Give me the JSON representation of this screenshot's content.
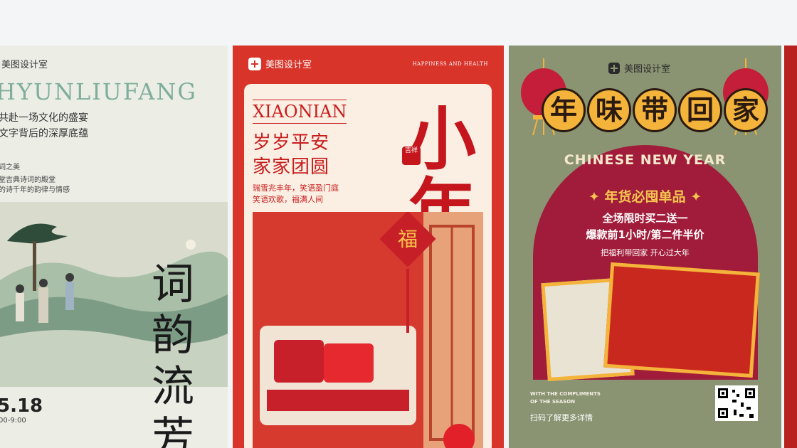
{
  "cards": [
    {
      "brand": "美图设计室",
      "latin": "HYUNLIUFANG",
      "line1": "共赴一场文化的盛宴",
      "line2": "文字背后的深厚底蕴",
      "small1": "词之美",
      "small2": "堂吉典诗词的殿堂",
      "small3": "的诗千年的韵律与情感",
      "vertical_title": "词韵流芳",
      "date": "5.18",
      "time": "00-9:00"
    },
    {
      "brand": "美图设计室",
      "tagline": "HAPPINESS AND HEALTH",
      "latin": "XIAONIAN",
      "heading1": "岁岁平安",
      "heading2": "家家团圆",
      "para1": "瑞雪兆丰年，笑语盈门庭",
      "para2": "笑语欢歌，福满人间",
      "big_char1": "小",
      "big_char2": "年",
      "seal": "吉祥",
      "fu": "福"
    },
    {
      "brand": "美图设计室",
      "title_chars": [
        "年",
        "味",
        "带",
        "回",
        "家"
      ],
      "cny": "CHINESE NEW YEAR",
      "goods": "✦ 年货必囤单品 ✦",
      "offer1": "全场限时买二送一",
      "offer2": "爆款前1小时/第二件半价",
      "offer3": "把福利带回家 开心过大年",
      "footer1": "WITH THE COMPLIMENTS",
      "footer2": "OF THE SEASON",
      "scan": "扫码了解更多详情"
    }
  ],
  "colors": {
    "red": "#d8342a",
    "olive": "#8a9472",
    "maroon": "#a01c3a",
    "gold": "#f4b33a"
  }
}
